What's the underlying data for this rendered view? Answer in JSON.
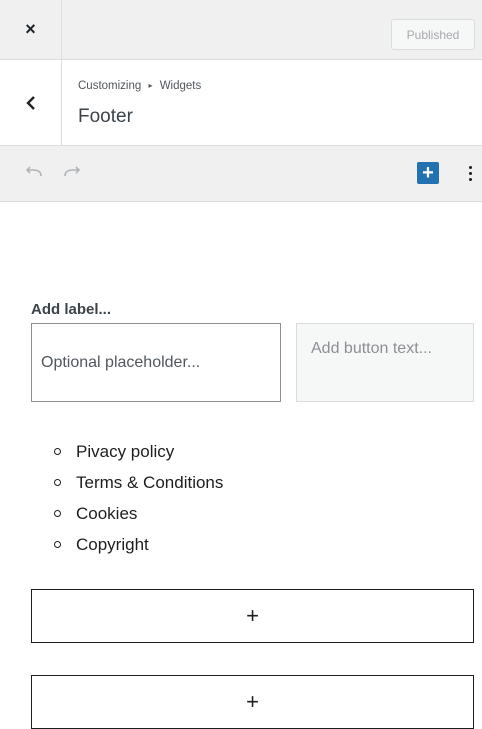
{
  "topbar": {
    "close_label": "×",
    "status_label": "Published"
  },
  "header": {
    "breadcrumb_parent": "Customizing",
    "breadcrumb_separator": "▸",
    "breadcrumb_current": "Widgets",
    "title": "Footer"
  },
  "toolbar": {
    "undo_icon": "undo-icon",
    "redo_icon": "redo-icon",
    "add_block_label": "+",
    "more_icon": "more-vertical-icon",
    "accent_color": "#2271b1"
  },
  "search_block": {
    "label": "Add label...",
    "input_placeholder": "Optional placeholder...",
    "button_placeholder": "Add button text..."
  },
  "links": [
    "Pivacy policy",
    "Terms & Conditions",
    "Cookies",
    "Copyright"
  ],
  "appenders": [
    {
      "label": "+"
    },
    {
      "label": "+"
    }
  ]
}
